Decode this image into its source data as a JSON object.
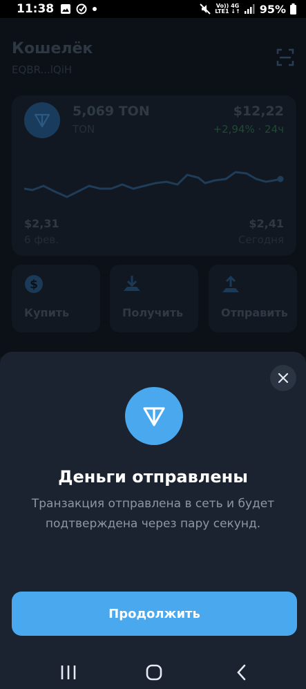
{
  "status_bar": {
    "time": "11:38",
    "net_top": "Vo)) 4G",
    "net_bottom": "LTE1 ↓↑",
    "battery": "95%"
  },
  "wallet": {
    "title": "Кошелёк",
    "address": "EQBR...lQiH",
    "balance": "5,069 TON",
    "ticker": "TON",
    "fiat_value": "$12,22",
    "change": "+2,94% · 24ч",
    "price_low": "$2,31",
    "price_low_date": "6 фев.",
    "price_high": "$2,41",
    "price_high_date": "Сегодня",
    "actions": [
      {
        "label": "Купить",
        "icon": "dollar-icon"
      },
      {
        "label": "Получить",
        "icon": "download-icon"
      },
      {
        "label": "Отправить",
        "icon": "upload-icon"
      }
    ]
  },
  "sheet": {
    "title": "Деньги отправлены",
    "description": "Транзакция отправлена в сеть и будет подтверждена через пару секунд.",
    "continue_label": "Продолжить"
  },
  "colors": {
    "accent": "#4aa8ef",
    "sheet_bg": "#1b2330",
    "positive": "#1d4a33"
  }
}
